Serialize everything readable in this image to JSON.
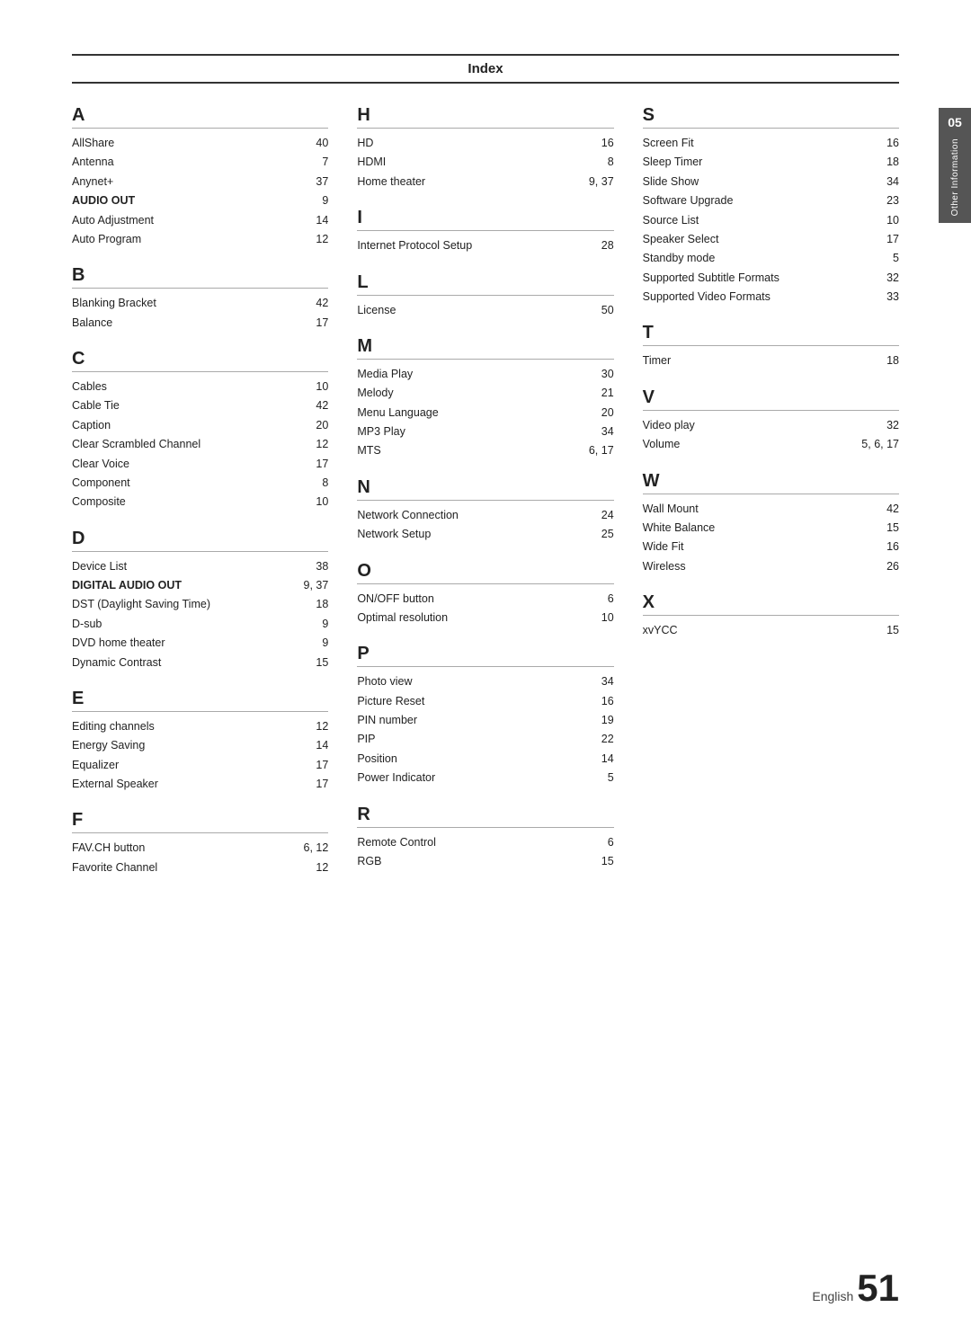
{
  "page": {
    "title": "Index",
    "tab": {
      "chapter": "05",
      "label": "Other Information"
    },
    "footer": {
      "english_label": "English",
      "page_number": "51"
    }
  },
  "columns": [
    {
      "sections": [
        {
          "header": "A",
          "entries": [
            {
              "name": "AllShare",
              "bold": false,
              "page": "40"
            },
            {
              "name": "Antenna",
              "bold": false,
              "page": "7"
            },
            {
              "name": "Anynet+",
              "bold": false,
              "page": "37"
            },
            {
              "name": "AUDIO OUT",
              "bold": true,
              "page": "9"
            },
            {
              "name": "Auto Adjustment",
              "bold": false,
              "page": "14"
            },
            {
              "name": "Auto Program",
              "bold": false,
              "page": "12"
            }
          ]
        },
        {
          "header": "B",
          "entries": [
            {
              "name": "Blanking Bracket",
              "bold": false,
              "page": "42"
            },
            {
              "name": "Balance",
              "bold": false,
              "page": "17"
            }
          ]
        },
        {
          "header": "C",
          "entries": [
            {
              "name": "Cables",
              "bold": false,
              "page": "10"
            },
            {
              "name": "Cable Tie",
              "bold": false,
              "page": "42"
            },
            {
              "name": "Caption",
              "bold": false,
              "page": "20"
            },
            {
              "name": "Clear Scrambled Channel",
              "bold": false,
              "page": "12"
            },
            {
              "name": "Clear Voice",
              "bold": false,
              "page": "17"
            },
            {
              "name": "Component",
              "bold": false,
              "page": "8"
            },
            {
              "name": "Composite",
              "bold": false,
              "page": "10"
            }
          ]
        },
        {
          "header": "D",
          "entries": [
            {
              "name": "Device List",
              "bold": false,
              "page": "38"
            },
            {
              "name": "DIGITAL AUDIO OUT",
              "bold": true,
              "page": "9, 37"
            },
            {
              "name": "DST (Daylight Saving Time)",
              "bold": false,
              "page": "18"
            },
            {
              "name": "D-sub",
              "bold": false,
              "page": "9"
            },
            {
              "name": "DVD home theater",
              "bold": false,
              "page": "9"
            },
            {
              "name": "Dynamic Contrast",
              "bold": false,
              "page": "15"
            }
          ]
        },
        {
          "header": "E",
          "entries": [
            {
              "name": "Editing channels",
              "bold": false,
              "page": "12"
            },
            {
              "name": "Energy Saving",
              "bold": false,
              "page": "14"
            },
            {
              "name": "Equalizer",
              "bold": false,
              "page": "17"
            },
            {
              "name": "External Speaker",
              "bold": false,
              "page": "17"
            }
          ]
        },
        {
          "header": "F",
          "entries": [
            {
              "name": "FAV.CH button",
              "bold": false,
              "page": "6, 12"
            },
            {
              "name": "Favorite Channel",
              "bold": false,
              "page": "12"
            }
          ]
        }
      ]
    },
    {
      "sections": [
        {
          "header": "H",
          "entries": [
            {
              "name": "HD",
              "bold": false,
              "page": "16"
            },
            {
              "name": "HDMI",
              "bold": false,
              "page": "8"
            },
            {
              "name": "Home theater",
              "bold": false,
              "page": "9, 37"
            }
          ]
        },
        {
          "header": "I",
          "entries": [
            {
              "name": "Internet Protocol Setup",
              "bold": false,
              "page": "28"
            }
          ]
        },
        {
          "header": "L",
          "entries": [
            {
              "name": "License",
              "bold": false,
              "page": "50"
            }
          ]
        },
        {
          "header": "M",
          "entries": [
            {
              "name": "Media Play",
              "bold": false,
              "page": "30"
            },
            {
              "name": "Melody",
              "bold": false,
              "page": "21"
            },
            {
              "name": "Menu Language",
              "bold": false,
              "page": "20"
            },
            {
              "name": "MP3 Play",
              "bold": false,
              "page": "34"
            },
            {
              "name": "MTS",
              "bold": false,
              "page": "6, 17"
            }
          ]
        },
        {
          "header": "N",
          "entries": [
            {
              "name": "Network Connection",
              "bold": false,
              "page": "24"
            },
            {
              "name": "Network Setup",
              "bold": false,
              "page": "25"
            }
          ]
        },
        {
          "header": "O",
          "entries": [
            {
              "name": "ON/OFF button",
              "bold": false,
              "page": "6"
            },
            {
              "name": "Optimal resolution",
              "bold": false,
              "page": "10"
            }
          ]
        },
        {
          "header": "P",
          "entries": [
            {
              "name": "Photo view",
              "bold": false,
              "page": "34"
            },
            {
              "name": "Picture Reset",
              "bold": false,
              "page": "16"
            },
            {
              "name": "PIN number",
              "bold": false,
              "page": "19"
            },
            {
              "name": "PIP",
              "bold": false,
              "page": "22"
            },
            {
              "name": "Position",
              "bold": false,
              "page": "14"
            },
            {
              "name": "Power Indicator",
              "bold": false,
              "page": "5"
            }
          ]
        },
        {
          "header": "R",
          "entries": [
            {
              "name": "Remote Control",
              "bold": false,
              "page": "6"
            },
            {
              "name": "RGB",
              "bold": false,
              "page": "15"
            }
          ]
        }
      ]
    },
    {
      "sections": [
        {
          "header": "S",
          "entries": [
            {
              "name": "Screen Fit",
              "bold": false,
              "page": "16"
            },
            {
              "name": "Sleep Timer",
              "bold": false,
              "page": "18"
            },
            {
              "name": "Slide Show",
              "bold": false,
              "page": "34"
            },
            {
              "name": "Software Upgrade",
              "bold": false,
              "page": "23"
            },
            {
              "name": "Source List",
              "bold": false,
              "page": "10"
            },
            {
              "name": "Speaker Select",
              "bold": false,
              "page": "17"
            },
            {
              "name": "Standby mode",
              "bold": false,
              "page": "5"
            },
            {
              "name": "Supported Subtitle Formats",
              "bold": false,
              "page": "32"
            },
            {
              "name": "Supported Video Formats",
              "bold": false,
              "page": "33"
            }
          ]
        },
        {
          "header": "T",
          "entries": [
            {
              "name": "Timer",
              "bold": false,
              "page": "18"
            }
          ]
        },
        {
          "header": "V",
          "entries": [
            {
              "name": "Video play",
              "bold": false,
              "page": "32"
            },
            {
              "name": "Volume",
              "bold": false,
              "page": "5, 6, 17"
            }
          ]
        },
        {
          "header": "W",
          "entries": [
            {
              "name": "Wall Mount",
              "bold": false,
              "page": "42"
            },
            {
              "name": "White Balance",
              "bold": false,
              "page": "15"
            },
            {
              "name": "Wide Fit",
              "bold": false,
              "page": "16"
            },
            {
              "name": "Wireless",
              "bold": false,
              "page": "26"
            }
          ]
        },
        {
          "header": "X",
          "entries": [
            {
              "name": "xvYCC",
              "bold": false,
              "page": "15"
            }
          ]
        }
      ]
    }
  ]
}
